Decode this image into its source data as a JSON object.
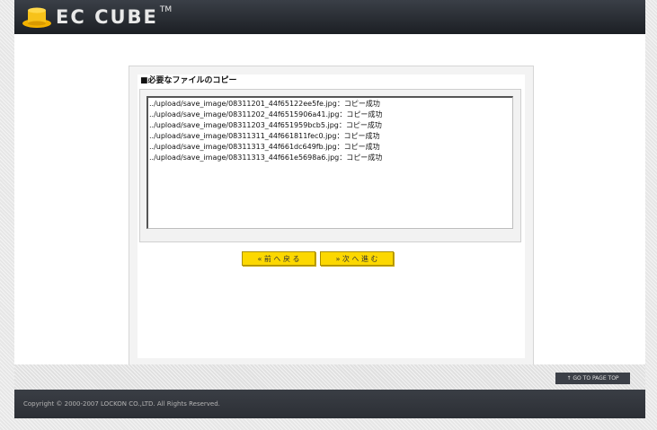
{
  "header": {
    "logo_text": "EC CUBE",
    "logo_tm": "TM"
  },
  "main": {
    "section_title": "■必要なファイルのコピー",
    "log_lines": [
      "../upload/save_image/08311201_44f65122ee5fe.jpg：コピー成功",
      "../upload/save_image/08311202_44f6515906a41.jpg：コピー成功",
      "../upload/save_image/08311203_44f651959bcb5.jpg：コピー成功",
      "../upload/save_image/08311311_44f661811fec0.jpg：コピー成功",
      "../upload/save_image/08311313_44f661dc649fb.jpg：コピー成功",
      "../upload/save_image/08311313_44f661e5698a6.jpg：コピー成功"
    ],
    "back_label": "«  前 へ 戻 る",
    "next_label": "»  次 へ 進 む"
  },
  "footer": {
    "pagetop_label": "↑ GO TO PAGE TOP",
    "copyright": "Copyright © 2000-2007 LOCKON CO.,LTD. All Rights Reserved."
  },
  "colors": {
    "button_yellow": "#fcd800",
    "header_dark": "#2a2d33",
    "logo_yellow": "#f2b100"
  }
}
